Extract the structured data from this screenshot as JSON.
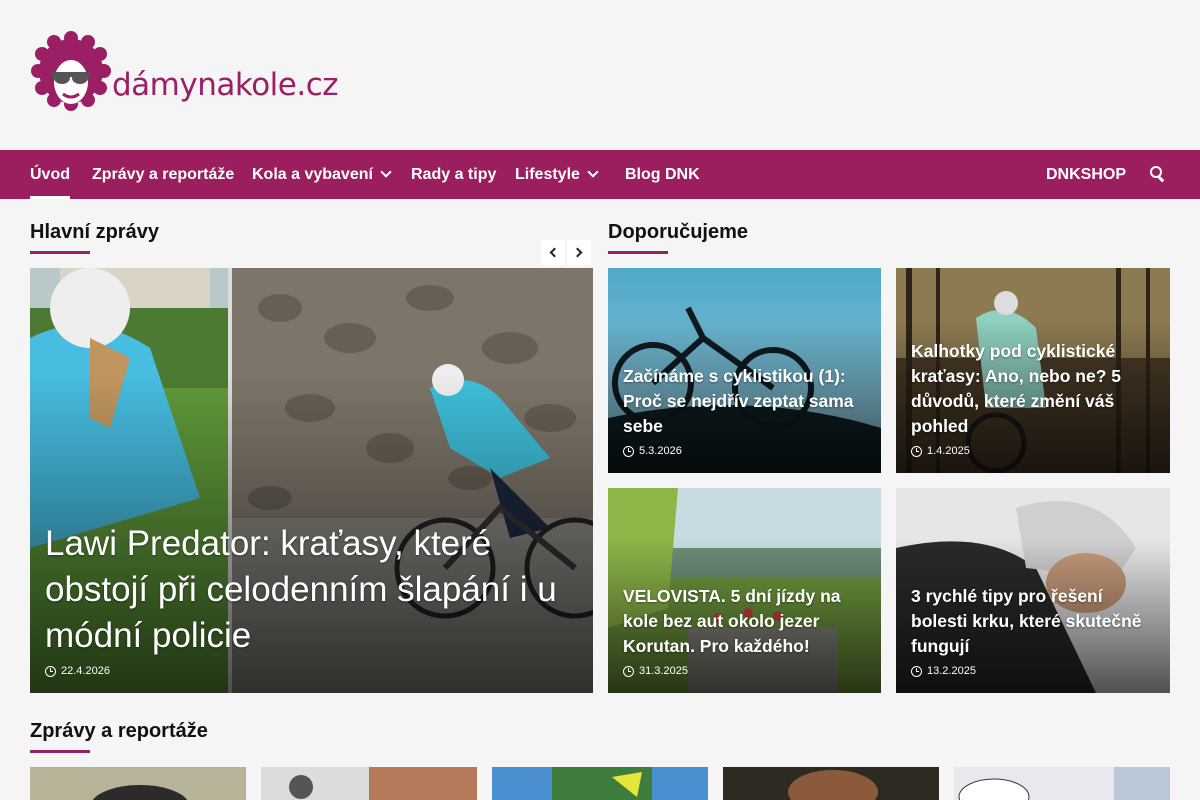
{
  "site": {
    "logo_text": "dámynakole.cz",
    "brand_color": "#9b1f5e"
  },
  "nav": {
    "items": [
      {
        "label": "Úvod",
        "active": true
      },
      {
        "label": "Zprávy a reportáže"
      },
      {
        "label": "Kola a vybavení",
        "dropdown": true
      },
      {
        "label": "Rady a tipy"
      },
      {
        "label": "Lifestyle",
        "dropdown": true
      },
      {
        "label": "Blog DNK"
      }
    ],
    "shop_label": "DNKSHOP",
    "search_icon": "search-icon"
  },
  "main_news": {
    "title": "Hlavní zprávy",
    "featured": {
      "title": "Lawi Predator: kraťasy, které obstojí při celodenním šlapání i u módní policie",
      "date": "22.4.2026"
    }
  },
  "recommended": {
    "title": "Doporučujeme",
    "cards": [
      {
        "title": "Začínáme s cyklistikou (1): Proč se nejdřív zeptat sama sebe",
        "date": "5.3.2026"
      },
      {
        "title": "Kalhotky pod cyklistické kraťasy: Ano, nebo ne? 5 důvodů, které změní váš pohled",
        "date": "1.4.2025"
      },
      {
        "title": "VELOVISTA. 5 dní jízdy na kole bez aut okolo jezer Korutan. Pro každého!",
        "date": "31.3.2025"
      },
      {
        "title": "3 rychlé tipy pro řešení bolesti krku, které skutečně fungují",
        "date": "13.2.2025"
      }
    ]
  },
  "news_reports": {
    "title": "Zprávy a reportáže"
  }
}
